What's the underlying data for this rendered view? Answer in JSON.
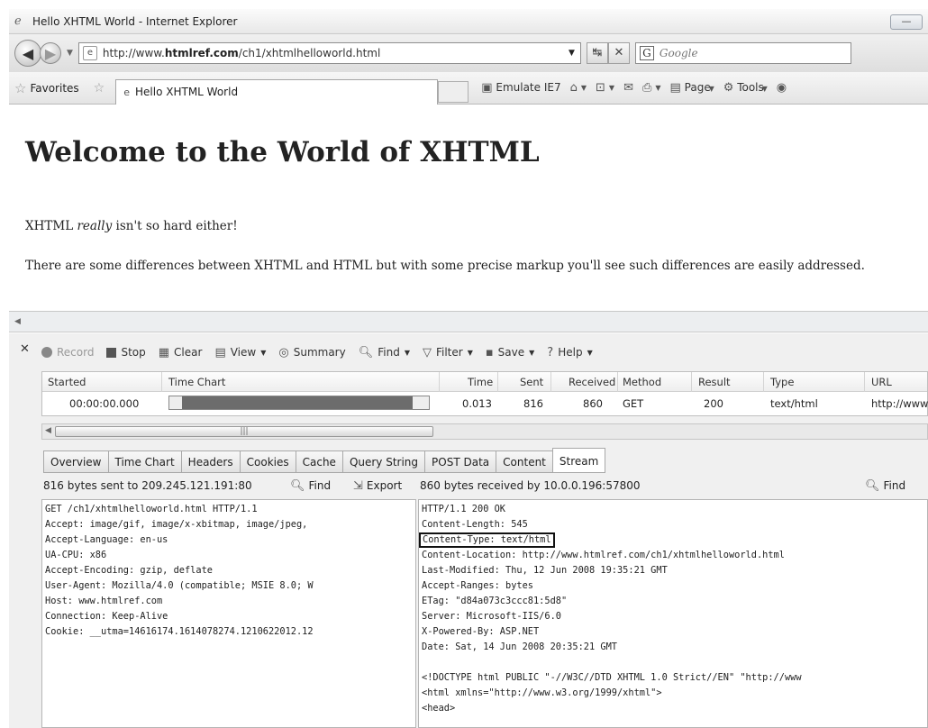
{
  "window": {
    "title": "Hello XHTML World - Internet Explorer"
  },
  "address_bar": {
    "url_prefix": "http://www.",
    "url_domain": "htmlref.com",
    "url_path": "/ch1/xhtmlhelloworld.html",
    "search_placeholder": "Google"
  },
  "favorites_bar": {
    "favorites_label": "Favorites",
    "tab_title": "Hello XHTML World",
    "emulate_label": "Emulate IE7",
    "page_label": "Page",
    "tools_label": "Tools"
  },
  "page": {
    "heading": "Welcome to the World of XHTML",
    "p1_prefix": "XHTML ",
    "p1_em": "really",
    "p1_suffix": " isn't so hard either!",
    "p2": "There are some differences between XHTML and HTML but with some precise markup you'll see such differences are easily addressed."
  },
  "devtools": {
    "toolbar": {
      "record": "Record",
      "stop": "Stop",
      "clear": "Clear",
      "view": "View",
      "summary": "Summary",
      "find": "Find",
      "filter": "Filter",
      "save": "Save",
      "help": "Help"
    },
    "columns": [
      "Started",
      "Time Chart",
      "Time",
      "Sent",
      "Received",
      "Method",
      "Result",
      "Type",
      "URL"
    ],
    "row": {
      "started": "00:00:00.000",
      "time": "0.013",
      "sent": "816",
      "received": "860",
      "method": "GET",
      "result": "200",
      "type": "text/html",
      "url": "http://www",
      "time_chart_fraction": 0.94
    },
    "tabs": [
      "Overview",
      "Time Chart",
      "Headers",
      "Cookies",
      "Cache",
      "Query String",
      "POST Data",
      "Content",
      "Stream"
    ],
    "active_tab": "Stream",
    "left_panel": {
      "header": "816 bytes sent to 209.245.121.191:80",
      "find": "Find",
      "export": "Export",
      "lines": [
        "GET /ch1/xhtmlhelloworld.html HTTP/1.1",
        "Accept: image/gif, image/x-xbitmap, image/jpeg,",
        "Accept-Language: en-us",
        "UA-CPU: x86",
        "Accept-Encoding: gzip, deflate",
        "User-Agent: Mozilla/4.0 (compatible; MSIE 8.0; W",
        "Host: www.htmlref.com",
        "Connection: Keep-Alive",
        "Cookie: __utma=14616174.1614078274.1210622012.12"
      ]
    },
    "right_panel": {
      "header": "860 bytes received by 10.0.0.196:57800",
      "find": "Find",
      "lines_a": [
        "HTTP/1.1 200 OK",
        "Content-Length: 545"
      ],
      "boxed": "Content-Type: text/html",
      "lines_b": [
        "Content-Location: http://www.htmlref.com/ch1/xhtmlhelloworld.html",
        "Last-Modified: Thu, 12 Jun 2008 19:35:21 GMT",
        "Accept-Ranges: bytes",
        "ETag: \"d84a073c3ccc81:5d8\"",
        "Server: Microsoft-IIS/6.0",
        "X-Powered-By: ASP.NET",
        "Date: Sat, 14 Jun 2008 20:35:21 GMT"
      ],
      "lines_c": [
        "<!DOCTYPE html PUBLIC \"-//W3C//DTD XHTML 1.0 Strict//EN\" \"http://www",
        "<html xmlns=\"http://www.w3.org/1999/xhtml\">",
        "<head>"
      ]
    }
  }
}
